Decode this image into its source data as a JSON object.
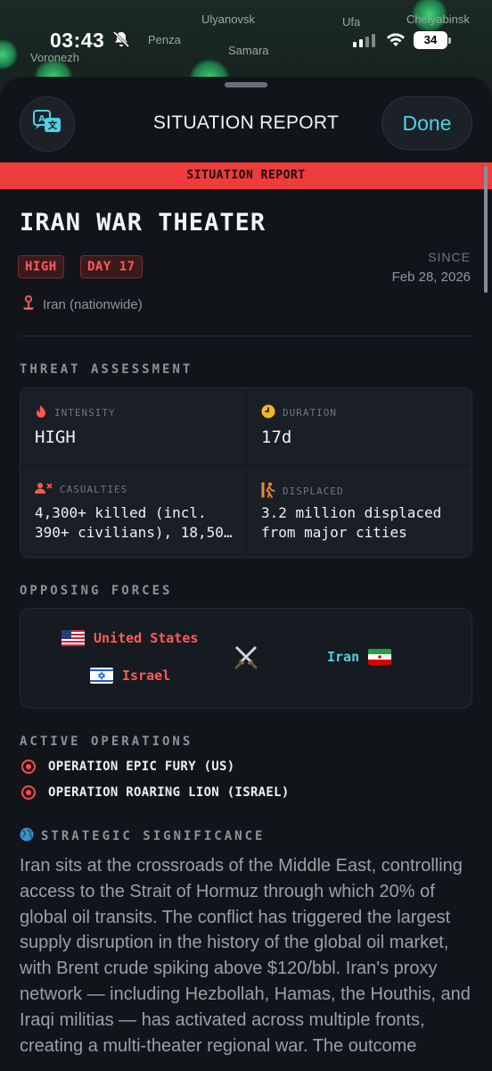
{
  "status_bar": {
    "time": "03:43",
    "battery": "34"
  },
  "map": {
    "labels": [
      "Ulyanovsk",
      "Ufa",
      "Chelyabinsk",
      "Penza",
      "Samara",
      "Voronezh"
    ]
  },
  "sheet": {
    "title": "SITUATION REPORT",
    "done_label": "Done",
    "banner": "SITUATION REPORT"
  },
  "region": {
    "title": "IRAN WAR THEATER",
    "badges": [
      "HIGH",
      "DAY 17"
    ],
    "since_label": "SINCE",
    "since_date": "Feb 28, 2026",
    "location": "Iran (nationwide)"
  },
  "threat": {
    "label": "THREAT ASSESSMENT",
    "intensity": {
      "label": "INTENSITY",
      "value": "HIGH"
    },
    "duration": {
      "label": "DURATION",
      "value": "17d"
    },
    "casualties": {
      "label": "CASUALTIES",
      "value": "4,300+ killed (incl. 390+ civilians), 18,50…"
    },
    "displaced": {
      "label": "DISPLACED",
      "value": "3.2 million displaced from major cities"
    }
  },
  "forces": {
    "label": "OPPOSING FORCES",
    "side_a": [
      "United States",
      "Israel"
    ],
    "side_b": [
      "Iran"
    ]
  },
  "operations": {
    "label": "ACTIVE OPERATIONS",
    "items": [
      "OPERATION EPIC FURY (US)",
      "OPERATION ROARING LION (ISRAEL)"
    ]
  },
  "significance": {
    "label": "STRATEGIC SIGNIFICANCE",
    "text": "Iran sits at the crossroads of the Middle East, controlling access to the Strait of Hormuz through which 20% of global oil transits. The conflict has triggered the largest supply disruption in the history of the global oil market, with Brent crude spiking above $120/bbl. Iran's proxy network — including Hezbollah, Hamas, the Houthis, and Iraqi militias — has activated across multiple fronts, creating a multi-theater regional war. The outcome"
  },
  "colors": {
    "accent": "#4fd1e6",
    "alert": "#ee3b3b",
    "background": "#11151a"
  }
}
